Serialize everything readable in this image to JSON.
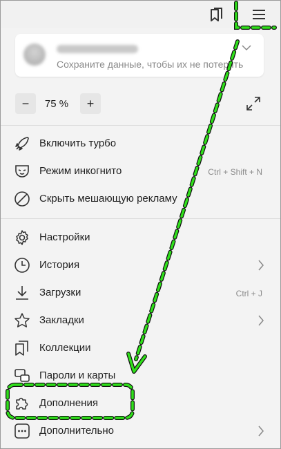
{
  "account": {
    "hint": "Сохраните данные, чтобы их не потерять"
  },
  "zoom": {
    "minus": "−",
    "value": "75 %",
    "plus": "+"
  },
  "menu": {
    "turbo": {
      "label": "Включить турбо",
      "icon": "rocket-icon"
    },
    "incognito": {
      "label": "Режим инкогнито",
      "shortcut": "Ctrl + Shift + N",
      "icon": "mask-icon"
    },
    "adblock": {
      "label": "Скрыть мешающую рекламу",
      "icon": "block-icon"
    },
    "settings": {
      "label": "Настройки",
      "icon": "gear-icon"
    },
    "history": {
      "label": "История",
      "icon": "clock-icon"
    },
    "downloads": {
      "label": "Загрузки",
      "shortcut": "Ctrl + J",
      "icon": "download-icon"
    },
    "bookmarks": {
      "label": "Закладки",
      "icon": "star-icon"
    },
    "collections": {
      "label": "Коллекции",
      "icon": "collections-icon"
    },
    "passwords": {
      "label": "Пароли и карты",
      "icon": "key-card-icon"
    },
    "extensions": {
      "label": "Дополнения",
      "icon": "puzzle-icon"
    },
    "more": {
      "label": "Дополнительно",
      "icon": "more-icon"
    }
  },
  "annotation": {
    "color": "#22dd11"
  }
}
